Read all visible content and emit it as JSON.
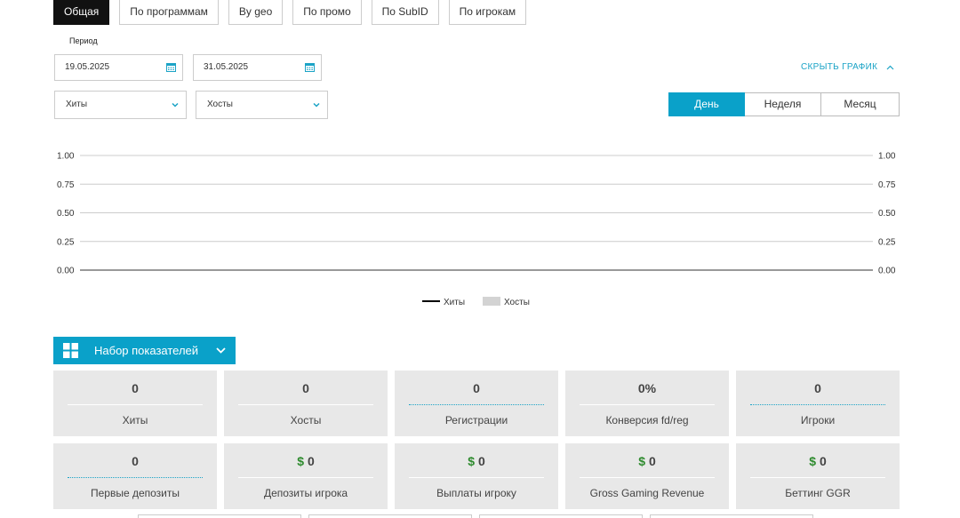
{
  "tabs": [
    {
      "label": "Общая",
      "active": true
    },
    {
      "label": "По программам",
      "active": false
    },
    {
      "label": "By geo",
      "active": false
    },
    {
      "label": "По промо",
      "active": false
    },
    {
      "label": "По SubID",
      "active": false
    },
    {
      "label": "По игрокам",
      "active": false
    }
  ],
  "period": {
    "label": "Период",
    "date_from": "19.05.2025",
    "date_to": "31.05.2025"
  },
  "hide_chart_label": "СКРЫТЬ ГРАФИК",
  "selects": {
    "metric1": "Хиты",
    "metric2": "Хосты"
  },
  "granularity": [
    {
      "label": "День",
      "active": true
    },
    {
      "label": "Неделя",
      "active": false
    },
    {
      "label": "Месяц",
      "active": false
    }
  ],
  "chart_data": {
    "type": "line",
    "y_ticks": [
      "1.00",
      "0.75",
      "0.50",
      "0.25",
      "0.00"
    ],
    "ylim": [
      0,
      1
    ],
    "series": [
      {
        "name": "Хиты",
        "color": "#000000",
        "values": []
      },
      {
        "name": "Хосты",
        "color": "#d3d3d3",
        "values": []
      }
    ],
    "legend_position": "bottom-center",
    "grid": true
  },
  "metrics_button": "Набор показателей",
  "cards": [
    {
      "value": "0",
      "currency": "",
      "label": "Хиты",
      "dotted": false
    },
    {
      "value": "0",
      "currency": "",
      "label": "Хосты",
      "dotted": false
    },
    {
      "value": "0",
      "currency": "",
      "label": "Регистрации",
      "dotted": true
    },
    {
      "value": "0%",
      "currency": "",
      "label": "Конверсия fd/reg",
      "dotted": false
    },
    {
      "value": "0",
      "currency": "",
      "label": "Игроки",
      "dotted": true
    },
    {
      "value": "0",
      "currency": "",
      "label": "Первые депозиты",
      "dotted": true
    },
    {
      "value": "0",
      "currency": "$",
      "label": "Депозиты игрока",
      "dotted": false
    },
    {
      "value": "0",
      "currency": "$",
      "label": "Выплаты игроку",
      "dotted": false
    },
    {
      "value": "0",
      "currency": "$",
      "label": "Gross Gaming Revenue",
      "dotted": false
    },
    {
      "value": "0",
      "currency": "$",
      "label": "Беттинг GGR",
      "dotted": false
    }
  ],
  "colors": {
    "accent": "#0aa1c9",
    "currency": "#2e8b2e",
    "card_bg": "#e8e8e8"
  }
}
